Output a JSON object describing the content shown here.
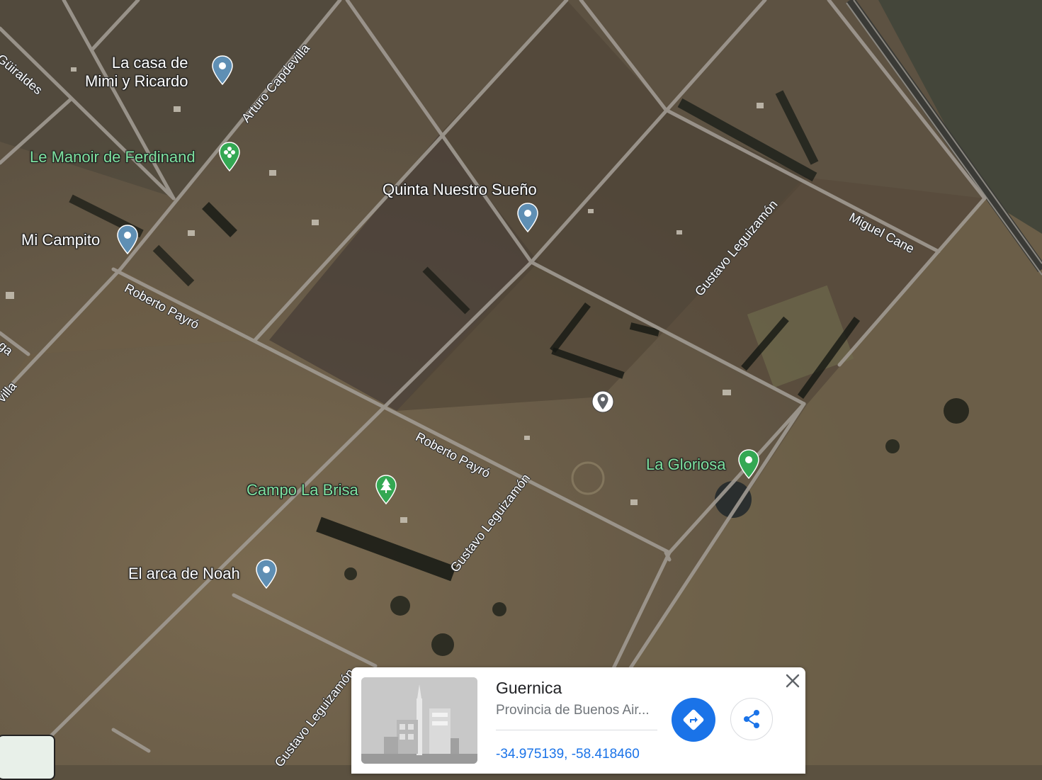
{
  "map": {
    "type": "satellite",
    "markers": [
      {
        "label_line1": "La casa de",
        "label_line2": "Mimi y Ricardo",
        "kind": "place",
        "color": "#5f8fb4"
      },
      {
        "label": "Le Manoir de Ferdinand",
        "kind": "flower-shop",
        "color": "#34a853"
      },
      {
        "label": "Quinta Nuestro Sueño",
        "kind": "place",
        "color": "#5f8fb4"
      },
      {
        "label": "Mi Campito",
        "kind": "place",
        "color": "#5f8fb4"
      },
      {
        "label": "Campo La Brisa",
        "kind": "park",
        "color": "#34a853"
      },
      {
        "label": "El arca de Noah",
        "kind": "place",
        "color": "#5f8fb4"
      },
      {
        "label": "La Gloriosa",
        "kind": "place",
        "color": "#34a853"
      }
    ],
    "streets": [
      "Güiraldes",
      "Arturo Capdevilla",
      "Roberto Payró",
      "Roberto Payró",
      "Miguel Cane",
      "Gustavo Leguizamón",
      "Gustavo Leguizamón",
      "Gustavo Leguizamón",
      "ga",
      "villa"
    ],
    "selected_pin_icon": "dropped-pin-icon"
  },
  "place_card": {
    "title": "Guernica",
    "subtitle": "Provincia de Buenos Air...",
    "coordinates": "-34.975139, -58.418460",
    "thumbnail_icon": "city-icon",
    "directions_icon": "directions-icon",
    "share_icon": "share-icon",
    "close_icon": "close-icon"
  },
  "colors": {
    "accent_blue": "#1a73e8",
    "green_label": "#7ee2a0",
    "road": "#a8a29a"
  }
}
